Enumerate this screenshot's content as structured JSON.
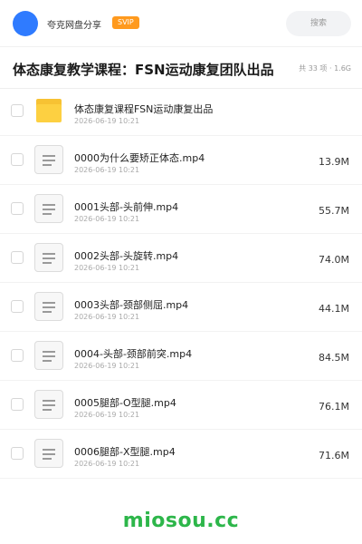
{
  "header": {
    "share_name": "夸克网盘分享",
    "badge": "SVIP",
    "search_label": "搜索"
  },
  "page": {
    "title": "体态康复教学课程：FSN运动康复团队出品",
    "meta": "共 33 项 · 1.6G"
  },
  "files": [
    {
      "name": "体态康复课程FSN运动康复出品",
      "date": "2026-06-19 10:21",
      "size": "",
      "type": "folder"
    },
    {
      "name": "0000为什么要矫正体态.mp4",
      "date": "2026-06-19 10:21",
      "size": "13.9M",
      "type": "video"
    },
    {
      "name": "0001头部-头前伸.mp4",
      "date": "2026-06-19 10:21",
      "size": "55.7M",
      "type": "video"
    },
    {
      "name": "0002头部-头旋转.mp4",
      "date": "2026-06-19 10:21",
      "size": "74.0M",
      "type": "video"
    },
    {
      "name": "0003头部-颈部侧屈.mp4",
      "date": "2026-06-19 10:21",
      "size": "44.1M",
      "type": "video"
    },
    {
      "name": "0004-头部-颈部前突.mp4",
      "date": "2026-06-19 10:21",
      "size": "84.5M",
      "type": "video"
    },
    {
      "name": "0005腿部-O型腿.mp4",
      "date": "2026-06-19 10:21",
      "size": "76.1M",
      "type": "video"
    },
    {
      "name": "0006腿部-X型腿.mp4",
      "date": "2026-06-19 10:21",
      "size": "71.6M",
      "type": "video"
    }
  ],
  "watermark": "miosou.cc",
  "colors": {
    "avatar": "#2f7bff",
    "svip_badge": "#ff9a1e",
    "folder": "#fdd041",
    "watermark": "#2db64a"
  }
}
